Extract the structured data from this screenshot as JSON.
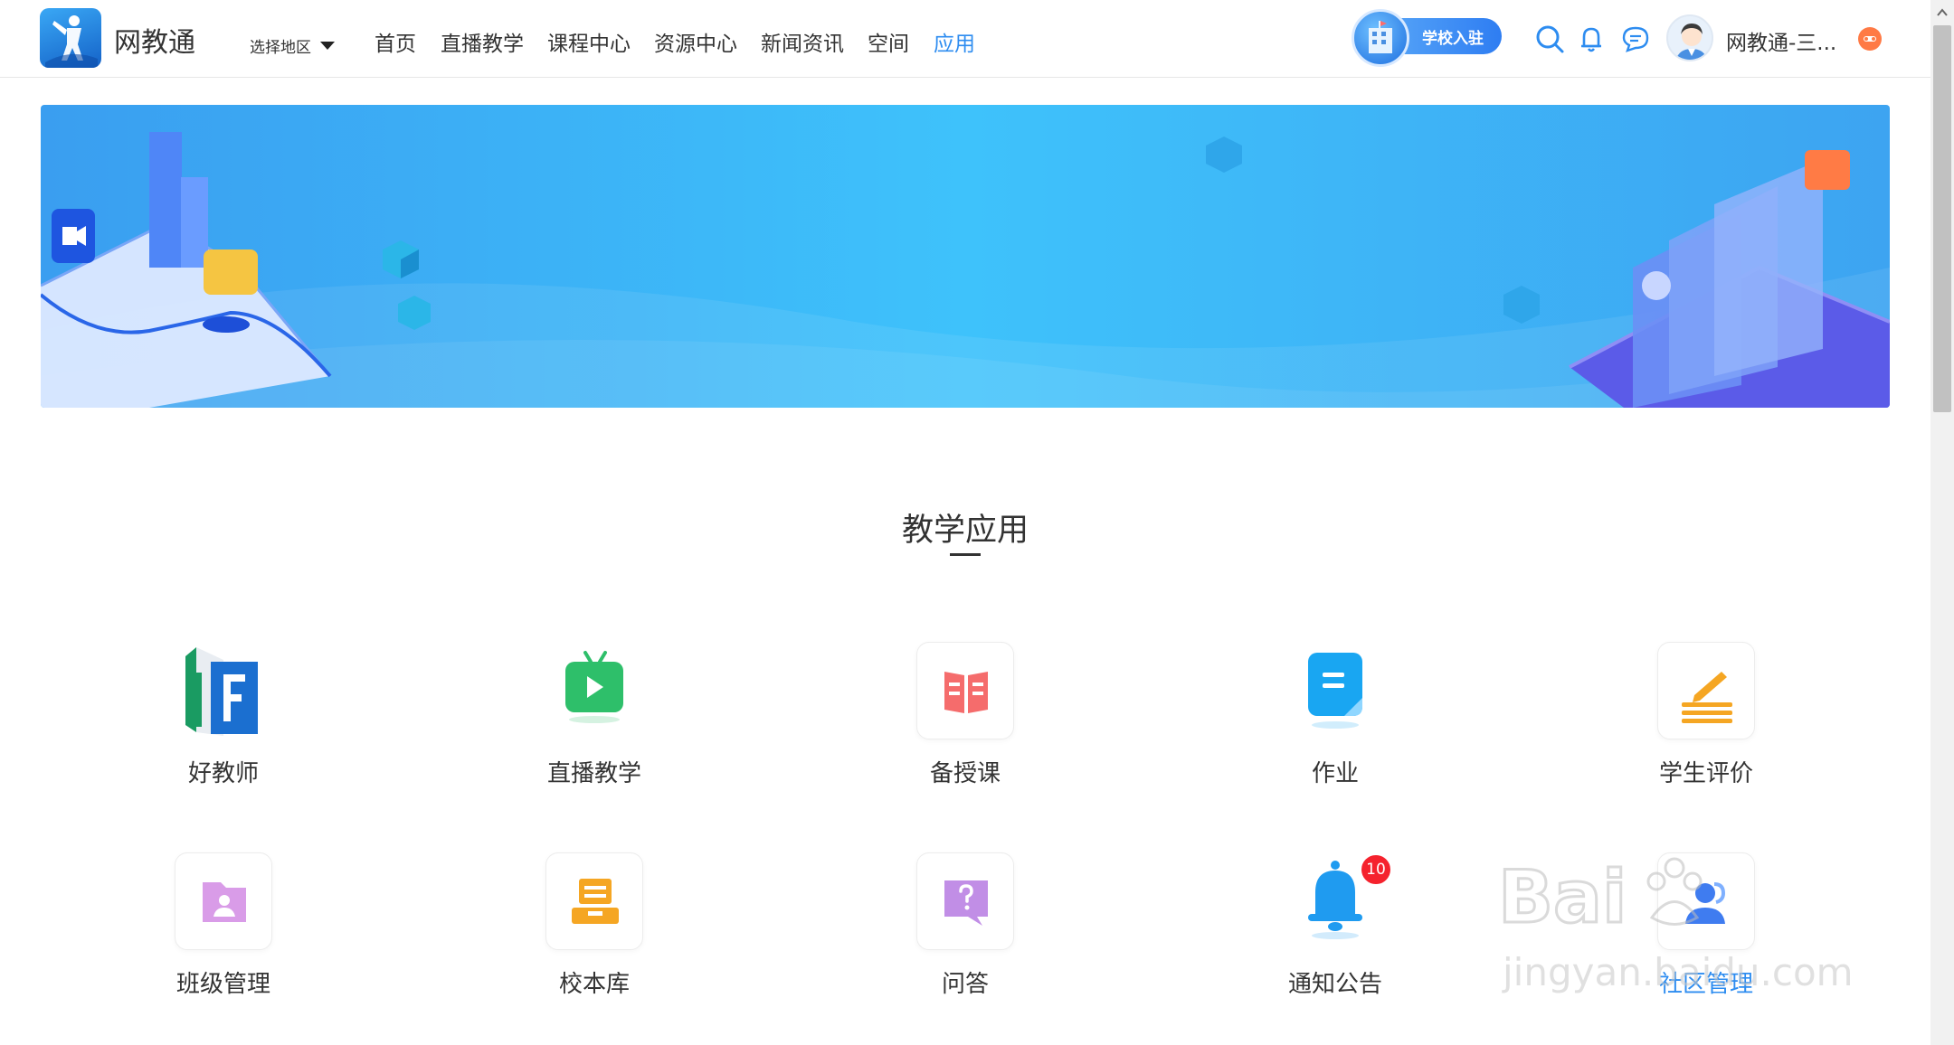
{
  "header": {
    "brand": "网教通",
    "region_label": "选择地区",
    "nav": [
      "首页",
      "直播教学",
      "课程中心",
      "资源中心",
      "新闻资讯",
      "空间",
      "应用"
    ],
    "active_nav": "应用",
    "school_button": "学校入驻",
    "username": "网教通-三..."
  },
  "section": {
    "title": "教学应用"
  },
  "apps": [
    {
      "name": "好教师",
      "icon": "good-teacher-icon"
    },
    {
      "name": "直播教学",
      "icon": "live-tv-icon"
    },
    {
      "name": "备授课",
      "icon": "lesson-book-icon"
    },
    {
      "name": "作业",
      "icon": "homework-doc-icon"
    },
    {
      "name": "学生评价",
      "icon": "evaluate-pen-icon"
    },
    {
      "name": "班级管理",
      "icon": "class-folder-icon"
    },
    {
      "name": "校本库",
      "icon": "school-library-icon"
    },
    {
      "name": "问答",
      "icon": "qa-bubble-icon"
    },
    {
      "name": "通知公告",
      "icon": "notice-bell-icon",
      "badge": "10"
    },
    {
      "name": "社区管理",
      "icon": "community-user-icon"
    }
  ],
  "colors": {
    "accent": "#2d8cf0",
    "badge": "#f5222d",
    "banner": "#3ec2fb"
  }
}
